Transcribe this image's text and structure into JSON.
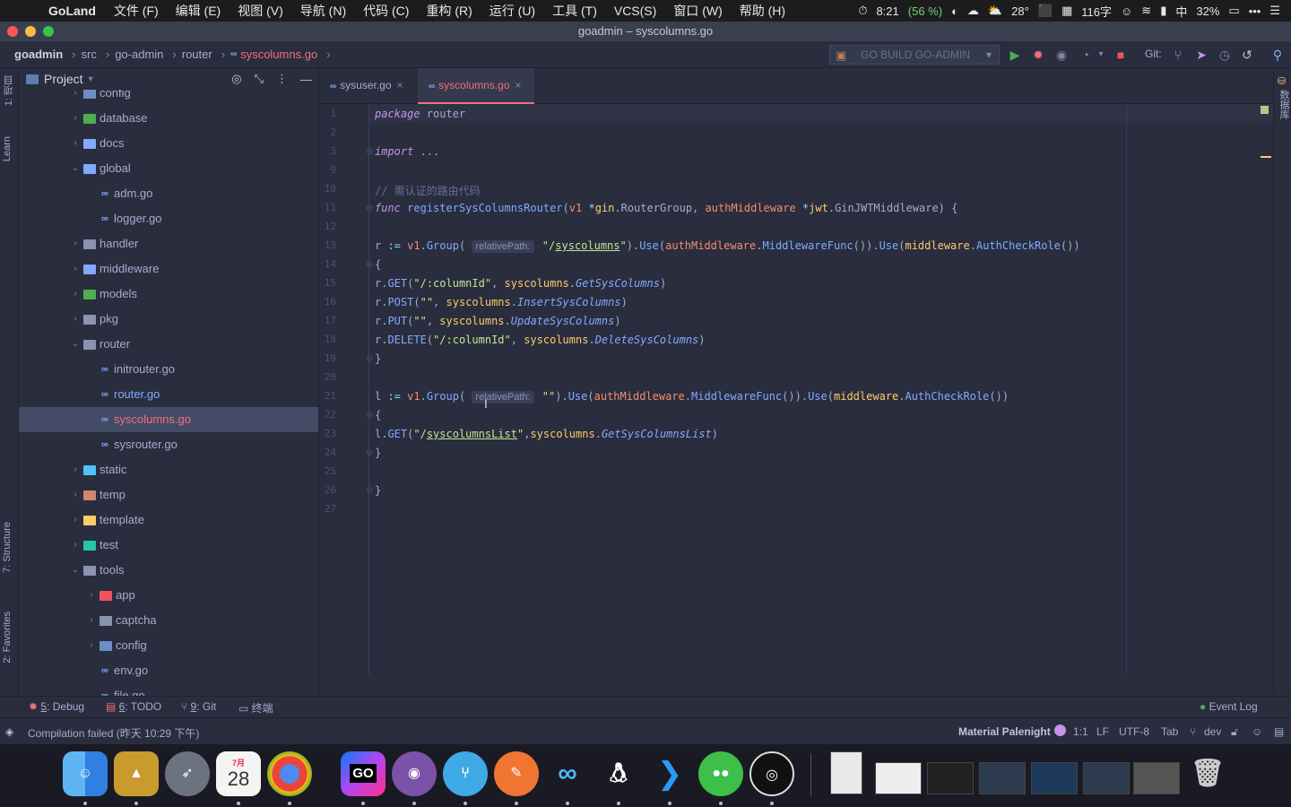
{
  "menubar": {
    "app": "GoLand",
    "items": [
      "文件 (F)",
      "编辑 (E)",
      "视图 (V)",
      "导航 (N)",
      "代码 (C)",
      "重构 (R)",
      "运行 (U)",
      "工具 (T)",
      "VCS(S)",
      "窗口 (W)",
      "帮助 (H)"
    ],
    "clock": "8:21",
    "battery_app": "(56 %)",
    "weather": "28°",
    "ime_count": "116字",
    "ime": "中",
    "battery": "32%"
  },
  "window": {
    "title": "goadmin – syscolumns.go"
  },
  "breadcrumb": [
    "goadmin",
    "src",
    "go-admin",
    "router",
    "syscolumns.go"
  ],
  "run_config": "GO BUILD GO-ADMIN",
  "git_label": "Git:",
  "project_panel": {
    "title": "Project"
  },
  "left_strip": {
    "project": "1: 项目",
    "learn": "Learn",
    "structure": "7: Structure",
    "favorites": "2: Favorites"
  },
  "right_strip": {
    "database": "数据库"
  },
  "tree": [
    {
      "name": "config",
      "type": "folder",
      "depth": 1,
      "open": false
    },
    {
      "name": "database",
      "type": "folder",
      "depth": 1,
      "open": false
    },
    {
      "name": "docs",
      "type": "folder",
      "depth": 1,
      "open": false
    },
    {
      "name": "global",
      "type": "folder",
      "depth": 1,
      "open": true
    },
    {
      "name": "adm.go",
      "type": "go",
      "depth": 2
    },
    {
      "name": "logger.go",
      "type": "go",
      "depth": 2
    },
    {
      "name": "handler",
      "type": "folder",
      "depth": 1,
      "open": false
    },
    {
      "name": "middleware",
      "type": "folder",
      "depth": 1,
      "open": false
    },
    {
      "name": "models",
      "type": "folder",
      "depth": 1,
      "open": false
    },
    {
      "name": "pkg",
      "type": "folder",
      "depth": 1,
      "open": false
    },
    {
      "name": "router",
      "type": "folder",
      "depth": 1,
      "open": true
    },
    {
      "name": "initrouter.go",
      "type": "go",
      "depth": 2
    },
    {
      "name": "router.go",
      "type": "go",
      "depth": 2
    },
    {
      "name": "syscolumns.go",
      "type": "go",
      "depth": 2,
      "selected": true
    },
    {
      "name": "sysrouter.go",
      "type": "go",
      "depth": 2
    },
    {
      "name": "static",
      "type": "folder",
      "depth": 1,
      "open": false
    },
    {
      "name": "temp",
      "type": "folder",
      "depth": 1,
      "open": false
    },
    {
      "name": "template",
      "type": "folder",
      "depth": 1,
      "open": false
    },
    {
      "name": "test",
      "type": "folder",
      "depth": 1,
      "open": false
    },
    {
      "name": "tools",
      "type": "folder",
      "depth": 1,
      "open": true
    },
    {
      "name": "app",
      "type": "folder",
      "depth": 2,
      "open": false
    },
    {
      "name": "captcha",
      "type": "folder",
      "depth": 2,
      "open": false
    },
    {
      "name": "config",
      "type": "folder",
      "depth": 2,
      "open": false
    },
    {
      "name": "env.go",
      "type": "go",
      "depth": 2
    },
    {
      "name": "file.go",
      "type": "go",
      "depth": 2
    }
  ],
  "tabs": [
    {
      "label": "sysuser.go",
      "active": false
    },
    {
      "label": "syscolumns.go",
      "active": true
    }
  ],
  "code_hint": "relativePath:",
  "bottom_tools": [
    {
      "num": "5",
      "label": ": Debug"
    },
    {
      "num": "6",
      "label": ": TODO"
    },
    {
      "num": "9",
      "label": ": Git"
    },
    {
      "num": "",
      "label": "终端"
    }
  ],
  "event_log": "Event Log",
  "status": {
    "message": "Compilation failed (昨天 10:29 下午)",
    "theme": "Material Palenight",
    "position": "1:1",
    "line_sep": "LF",
    "encoding": "UTF-8",
    "indent": "Tab",
    "branch": "dev"
  },
  "dock": {
    "calendar_month": "7月",
    "calendar_day": "28",
    "goland": "GO"
  }
}
